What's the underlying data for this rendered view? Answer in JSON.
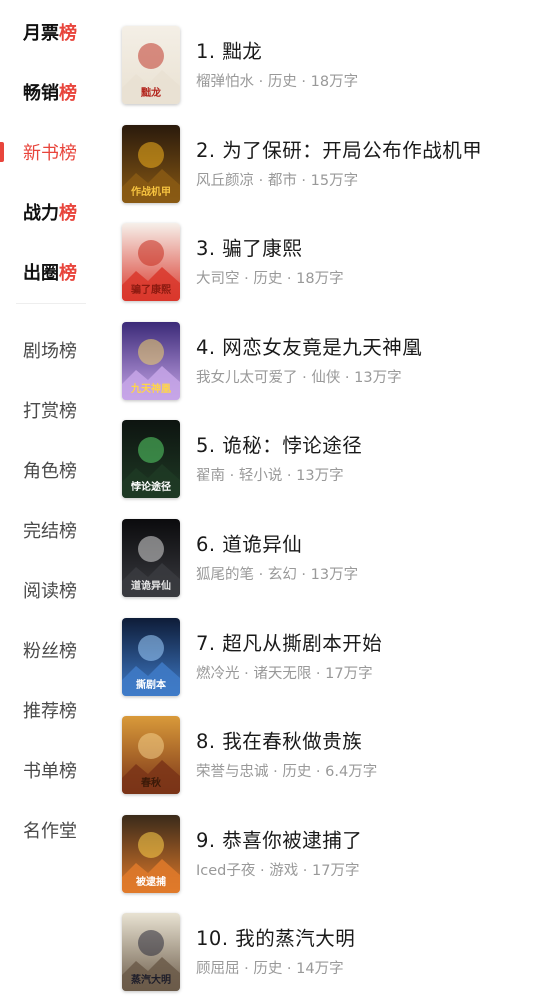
{
  "sidebar": {
    "featured": [
      {
        "head": "月票",
        "tail": "榜"
      },
      {
        "head": "畅销",
        "tail": "榜"
      },
      {
        "head": "新书榜",
        "tail": ""
      },
      {
        "head": "战力",
        "tail": "榜"
      },
      {
        "head": "出圈",
        "tail": "榜"
      }
    ],
    "others": [
      "剧场榜",
      "打赏榜",
      "角色榜",
      "完结榜",
      "阅读榜",
      "粉丝榜",
      "推荐榜",
      "书单榜",
      "名作堂"
    ],
    "active_index": 2
  },
  "books": [
    {
      "title": "1. 黜龙",
      "meta": "榴弹怕水 · 历史 · 18万字",
      "cover": {
        "bg1": "#f4efe6",
        "bg2": "#e9e1d2",
        "accent": "#c0392b",
        "text": "黜龙",
        "text_color": "#b3261e"
      }
    },
    {
      "title": "2. 为了保研：开局公布作战机甲",
      "meta": "风丘颜凉 · 都市 · 15万字",
      "cover": {
        "bg1": "#2a1a0c",
        "bg2": "#8a5a14",
        "accent": "#f2b01e",
        "text": "作战机甲",
        "text_color": "#f6c340"
      }
    },
    {
      "title": "3. 骗了康熙",
      "meta": "大司空 · 历史 · 18万字",
      "cover": {
        "bg1": "#f6f0ea",
        "bg2": "#d9372b",
        "accent": "#c62d1f",
        "text": "骗了康熙",
        "text_color": "#8b1a10"
      }
    },
    {
      "title": "4. 网恋女友竟是九天神凰",
      "meta": "我女儿太可爱了 · 仙侠 · 13万字",
      "cover": {
        "bg1": "#3b2a78",
        "bg2": "#c7a6e8",
        "accent": "#f1d36b",
        "text": "九天神凰",
        "text_color": "#ffd54a"
      }
    },
    {
      "title": "5. 诡秘：悖论途径",
      "meta": "翟南 · 轻小说 · 13万字",
      "cover": {
        "bg1": "#0d1410",
        "bg2": "#1f3a25",
        "accent": "#58d36a",
        "text": "悖论途径",
        "text_color": "#ffffff"
      }
    },
    {
      "title": "6. 道诡异仙",
      "meta": "狐尾的笔 · 玄幻 · 13万字",
      "cover": {
        "bg1": "#0b0b0d",
        "bg2": "#3a3b40",
        "accent": "#d8d8d8",
        "text": "道诡异仙",
        "text_color": "#e6e6e6"
      }
    },
    {
      "title": "7. 超凡从撕剧本开始",
      "meta": "燃冷光 · 诸天无限 · 17万字",
      "cover": {
        "bg1": "#0e1c38",
        "bg2": "#3f7bc8",
        "accent": "#9fd0ff",
        "text": "撕剧本",
        "text_color": "#ffffff"
      }
    },
    {
      "title": "8. 我在春秋做贵族",
      "meta": "荣誉与忠诚 · 历史 · 6.4万字",
      "cover": {
        "bg1": "#d99a3a",
        "bg2": "#7a3418",
        "accent": "#f4d08a",
        "text": "春秋",
        "text_color": "#3b1a08"
      }
    },
    {
      "title": "9. 恭喜你被逮捕了",
      "meta": "Iced子夜 · 游戏 · 17万字",
      "cover": {
        "bg1": "#3a2a1a",
        "bg2": "#e07a2a",
        "accent": "#ffd24a",
        "text": "被逮捕",
        "text_color": "#ffffff"
      }
    },
    {
      "title": "10. 我的蒸汽大明",
      "meta": "顾屈屈 · 历史 · 14万字",
      "cover": {
        "bg1": "#e8e2d2",
        "bg2": "#6b5b49",
        "accent": "#2b2b3a",
        "text": "蒸汽大明",
        "text_color": "#1e1e2a"
      }
    }
  ]
}
